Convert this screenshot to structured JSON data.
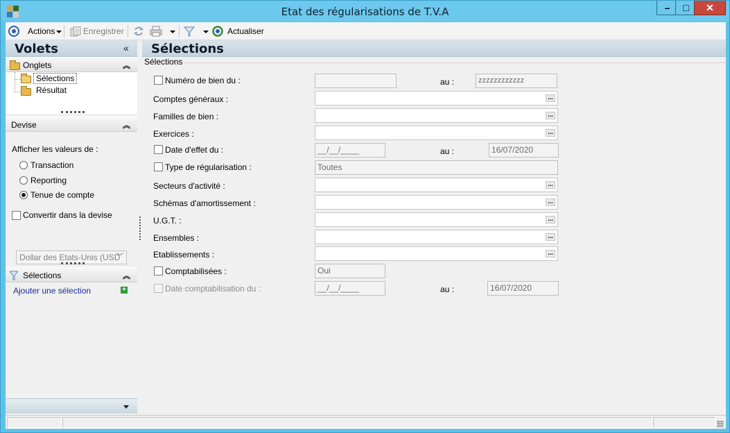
{
  "window": {
    "title": "Etat des régularisations de T.V.A",
    "min_glyph": "–",
    "max_glyph": "□",
    "close_glyph": "✕"
  },
  "toolbar": {
    "actions_label": "Actions",
    "save_label": "Enregistrer",
    "refresh_label": "Actualiser"
  },
  "left_pane": {
    "title": "Volets",
    "collapse_glyph": "«",
    "tabs_section": {
      "title": "Onglets",
      "items": [
        {
          "label": "Sélections",
          "selected": true
        },
        {
          "label": "Résultat",
          "selected": false
        }
      ]
    },
    "currency_section": {
      "title": "Devise",
      "display_label": "Afficher les valeurs de :",
      "options": [
        {
          "label": "Transaction",
          "checked": false
        },
        {
          "label": "Reporting",
          "checked": false
        },
        {
          "label": "Tenue de compte",
          "checked": true
        }
      ],
      "convert_label": "Convertir dans la devise",
      "convert_checked": false,
      "currency_value": "Dollar des Etats-Unis (USD"
    },
    "selections_section": {
      "title": "Sélections",
      "add_link": "Ajouter une sélection",
      "add_glyph": "+"
    },
    "chevron_up": "⌃"
  },
  "main": {
    "title": "Sélections",
    "group_label": "Sélections",
    "fields": {
      "asset_number": {
        "label": "Numéro de bien du :",
        "from": "",
        "to_label": "au :",
        "to": "zzzzzzzzzzzz"
      },
      "general_accounts": {
        "label": "Comptes généraux :",
        "value": ""
      },
      "asset_families": {
        "label": "Familles de bien :",
        "value": ""
      },
      "fiscal_years": {
        "label": "Exercices :",
        "value": ""
      },
      "effective_date": {
        "label": "Date d'effet du :",
        "from": "__/__/____",
        "to_label": "au :",
        "to": "16/07/2020"
      },
      "regularisation_type": {
        "label": "Type de régularisation :",
        "value": "Toutes"
      },
      "activity_sectors": {
        "label": "Secteurs d'activité :",
        "value": ""
      },
      "depreciation_schemes": {
        "label": "Schémas d'amortissement :",
        "value": ""
      },
      "ugt": {
        "label": "U.G.T. :",
        "value": ""
      },
      "sets": {
        "label": "Ensembles :",
        "value": ""
      },
      "establishments": {
        "label": "Etablissements :",
        "value": ""
      },
      "posted": {
        "label": "Comptabilisées :",
        "value": "Oui"
      },
      "posting_date": {
        "label": "Date comptabilisation du :",
        "from": "__/__/____",
        "to_label": "au :",
        "to": "16/07/2020"
      }
    },
    "ellipsis_glyph": "..."
  },
  "colors": {
    "title_bar": "#6cc8ec",
    "close_button": "#c9483d",
    "pane_header": "#c3d3de",
    "link": "#1a2c9a"
  }
}
